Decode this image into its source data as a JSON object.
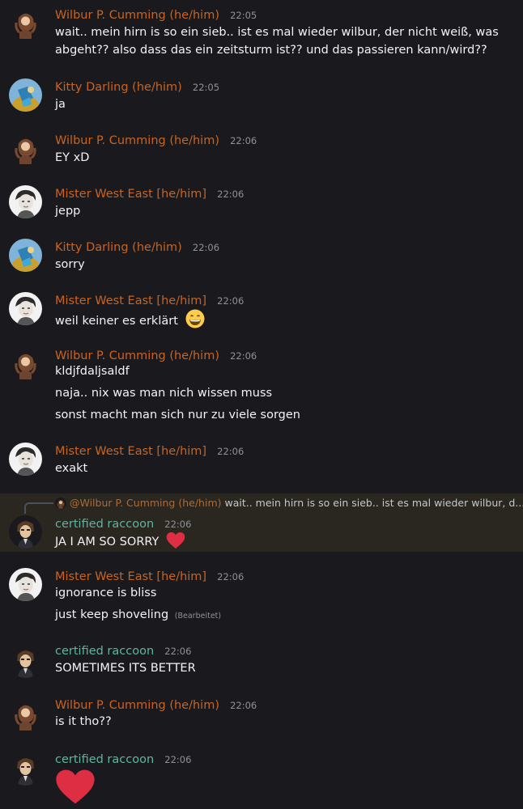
{
  "colors": {
    "background": "#1a1a1e",
    "highlight": "#2a2620",
    "name_orange": "#c9641f",
    "name_green": "#5fb5a0",
    "heart": "#dd2e44"
  },
  "messages": [
    {
      "author": "Wilbur P. Cumming (he/him)",
      "time": "22:05",
      "avatar": "wilbur-avatar",
      "lines": [
        "wait.. mein hirn is so ein sieb.. ist es mal wieder wilbur, der nicht weiß, was abgeht?? also dass das ein zeitsturm ist?? und das passieren kann/wird??"
      ]
    },
    {
      "author": "Kitty Darling (he/him)",
      "time": "22:05",
      "avatar": "kitty-avatar",
      "lines": [
        "ja"
      ]
    },
    {
      "author": "Wilbur P. Cumming (he/him)",
      "time": "22:06",
      "avatar": "wilbur-avatar",
      "lines": [
        "EY xD"
      ]
    },
    {
      "author": "Mister West East [he/him]",
      "time": "22:06",
      "avatar": "mister-avatar",
      "lines": [
        "jepp"
      ]
    },
    {
      "author": "Kitty Darling (he/him)",
      "time": "22:06",
      "avatar": "kitty-avatar",
      "lines": [
        "sorry"
      ]
    },
    {
      "author": "Mister West East [he/him]",
      "time": "22:06",
      "avatar": "mister-avatar",
      "lines": [
        "weil keiner es erklärt"
      ],
      "emoji": "grinning-face-emoji"
    },
    {
      "author": "Wilbur P. Cumming (he/him)",
      "time": "22:06",
      "avatar": "wilbur-avatar",
      "lines": [
        "kldjfdaljsaldf",
        "naja.. nix was man nich wissen muss",
        "sonst macht man sich nur zu viele sorgen"
      ]
    },
    {
      "author": "Mister West East [he/him]",
      "time": "22:06",
      "avatar": "mister-avatar",
      "lines": [
        "exakt"
      ]
    },
    {
      "author": "certified raccoon",
      "time": "22:06",
      "avatar": "raccoon-avatar",
      "reply": {
        "mention": "@Wilbur P. Cumming (he/him)",
        "text": "wait.. mein hirn is so ein sieb.. ist es mal wieder wilbur, d..."
      },
      "lines": [
        "JA I AM SO SORRY"
      ],
      "emoji": "red-heart-emoji"
    },
    {
      "author": "Mister West East [he/him]",
      "time": "22:06",
      "avatar": "mister-avatar",
      "lines": [
        "ignorance is bliss",
        "just keep shoveling"
      ],
      "edited": "(Bearbeitet)"
    },
    {
      "author": "certified raccoon",
      "time": "22:06",
      "avatar": "raccoon-avatar",
      "lines": [
        "SOMETIMES ITS BETTER"
      ]
    },
    {
      "author": "Wilbur P. Cumming (he/him)",
      "time": "22:06",
      "avatar": "wilbur-avatar",
      "lines": [
        "is it tho??"
      ]
    },
    {
      "author": "certified raccoon",
      "time": "22:06",
      "avatar": "raccoon-avatar",
      "lines": [],
      "emoji": "big-red-heart-emoji"
    }
  ]
}
